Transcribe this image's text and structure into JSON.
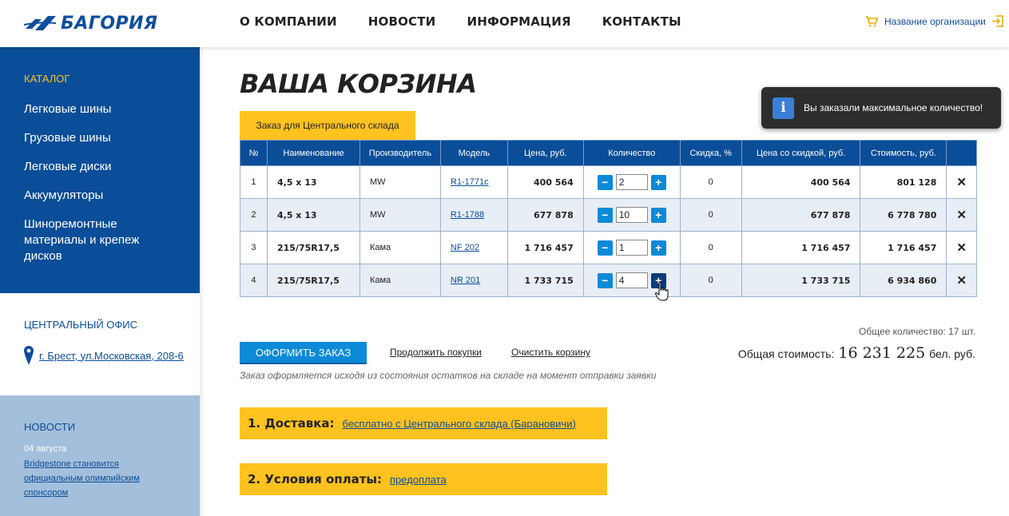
{
  "header": {
    "logo_text": "БАГОРИЯ",
    "nav": [
      "О КОМПАНИИ",
      "НОВОСТИ",
      "ИНФОРМАЦИЯ",
      "КОНТАКТЫ"
    ],
    "org_name": "Название организации",
    "icons": {
      "cart": "cart-icon",
      "login": "login-icon"
    },
    "accent": "#ffc21e",
    "brand": "#0a4d98"
  },
  "sidebar": {
    "catalog_title": "КАТАЛОГ",
    "catalog_items": [
      "Легковые шины",
      "Грузовые шины",
      "Легковые диски",
      "Аккумуляторы",
      "Шиноремонтные материалы и крепеж дисков"
    ],
    "office_title": "ЦЕНТРАЛЬНЫЙ ОФИС",
    "office_address": "г. Брест, ул.Московская, 208-6",
    "news_title": "НОВОСТИ",
    "news_date": "04 августа",
    "news_link": "Bridgestone становится официальным олимпийским спонсором"
  },
  "main": {
    "title": "ВАША КОРЗИНА",
    "tab": "Заказ для Центрального склада",
    "columns": [
      "№",
      "Наименование",
      "Производитель",
      "Модель",
      "Цена, руб.",
      "Количество",
      "Скидка, %",
      "Цена со скидкой, руб.",
      "Стоимость, руб.",
      ""
    ],
    "rows": [
      {
        "n": "1",
        "name": "4,5 х 13",
        "maker": "MW",
        "model": "R1-1771c",
        "price": "400 564",
        "qty": "2",
        "discount": "0",
        "disc_price": "400 564",
        "cost": "801 128"
      },
      {
        "n": "2",
        "name": "4,5 х 13",
        "maker": "MW",
        "model": "R1-1788",
        "price": "677 878",
        "qty": "10",
        "discount": "0",
        "disc_price": "677 878",
        "cost": "6 778 780"
      },
      {
        "n": "3",
        "name": "215/75R17,5",
        "maker": "Кама",
        "model": "NF 202",
        "price": "1 716 457",
        "qty": "1",
        "discount": "0",
        "disc_price": "1 716 457",
        "cost": "1 716 457"
      },
      {
        "n": "4",
        "name": "215/75R17,5",
        "maker": "Кама",
        "model": "NR 201",
        "price": "1 733 715",
        "qty": "4",
        "discount": "0",
        "disc_price": "1 733 715",
        "cost": "6 934 860"
      }
    ],
    "minus": "−",
    "plus": "+",
    "delete": "✕",
    "total_qty": "Общее количество: 17 шт.",
    "total_label": "Общая стоимость:",
    "total_value": "16 231 225",
    "total_currency": "бел. руб.",
    "order_button": "ОФОРМИТЬ ЗАКАЗ",
    "continue_link": "Продолжить покупки",
    "clear_link": "Очистить корзину",
    "note": "Заказ оформляется исходя из состояния остатков на складе на момент отправки заявки",
    "delivery_label": "1. Доставка:",
    "delivery_value": "бесплатно с Центрального склада (Барановичи)",
    "payment_label": "2. Условия оплаты:",
    "payment_value": "предоплата"
  },
  "toast": {
    "icon": "i",
    "message": "Вы заказали максимальное количество!"
  }
}
